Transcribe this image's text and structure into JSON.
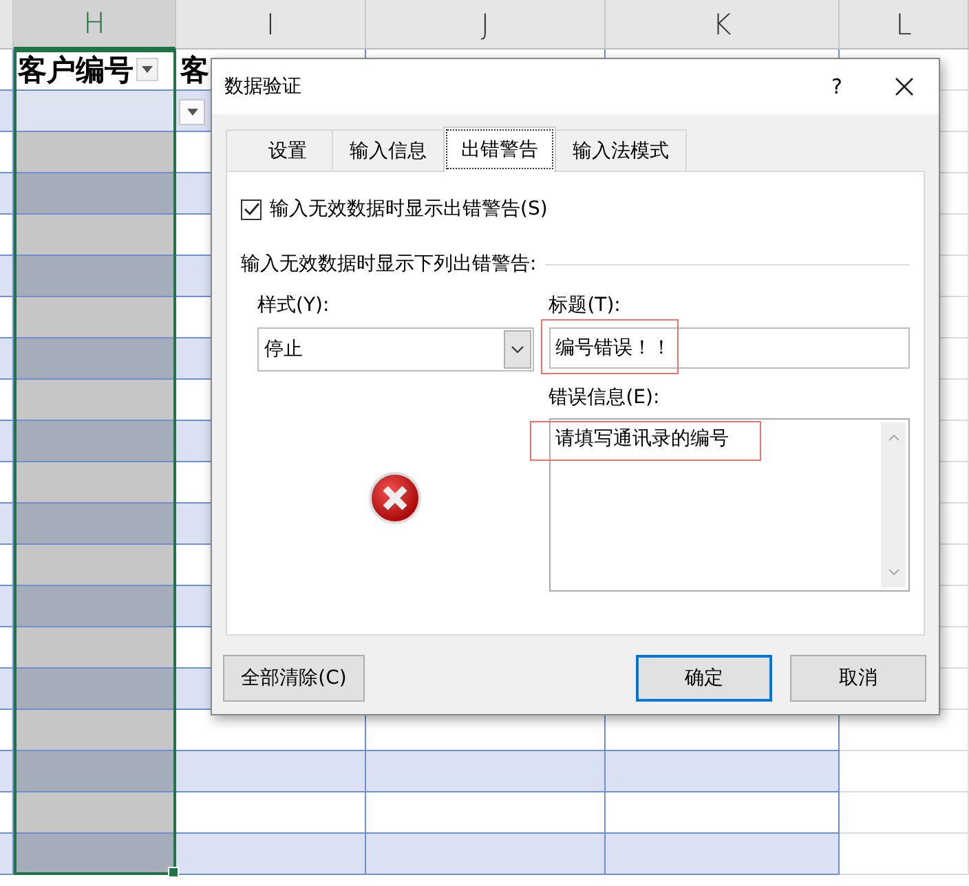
{
  "sheet": {
    "columns": [
      {
        "label": "H",
        "selected": true
      },
      {
        "label": "I",
        "selected": false
      },
      {
        "label": "J",
        "selected": false
      },
      {
        "label": "K",
        "selected": false
      },
      {
        "label": "L",
        "selected": false
      }
    ],
    "table_header": [
      {
        "text": "客户编号",
        "filter": true
      },
      {
        "text": "客"
      }
    ],
    "cell_dropdown": true
  },
  "dialog": {
    "title": "数据验证",
    "help": "?",
    "tabs": [
      {
        "label": "设置",
        "selected": false
      },
      {
        "label": "输入信息",
        "selected": false
      },
      {
        "label": "出错警告",
        "selected": true
      },
      {
        "label": "输入法模式",
        "selected": false
      }
    ],
    "show_alert": {
      "label": "输入无效数据时显示出错警告(S)",
      "checked": true
    },
    "section_label": "输入无效数据时显示下列出错警告:",
    "style": {
      "label": "样式(Y):",
      "value": "停止"
    },
    "title_field": {
      "label": "标题(T):",
      "value": "编号错误！！",
      "highlighted": true
    },
    "message_field": {
      "label": "错误信息(E):",
      "value": "请填写通讯录的编号",
      "highlighted": true
    },
    "buttons": [
      {
        "kind": "clear",
        "label": "全部清除(C)",
        "default": false
      },
      {
        "kind": "ok",
        "label": "确定",
        "default": true
      },
      {
        "kind": "cancel",
        "label": "取消",
        "default": false
      }
    ]
  }
}
